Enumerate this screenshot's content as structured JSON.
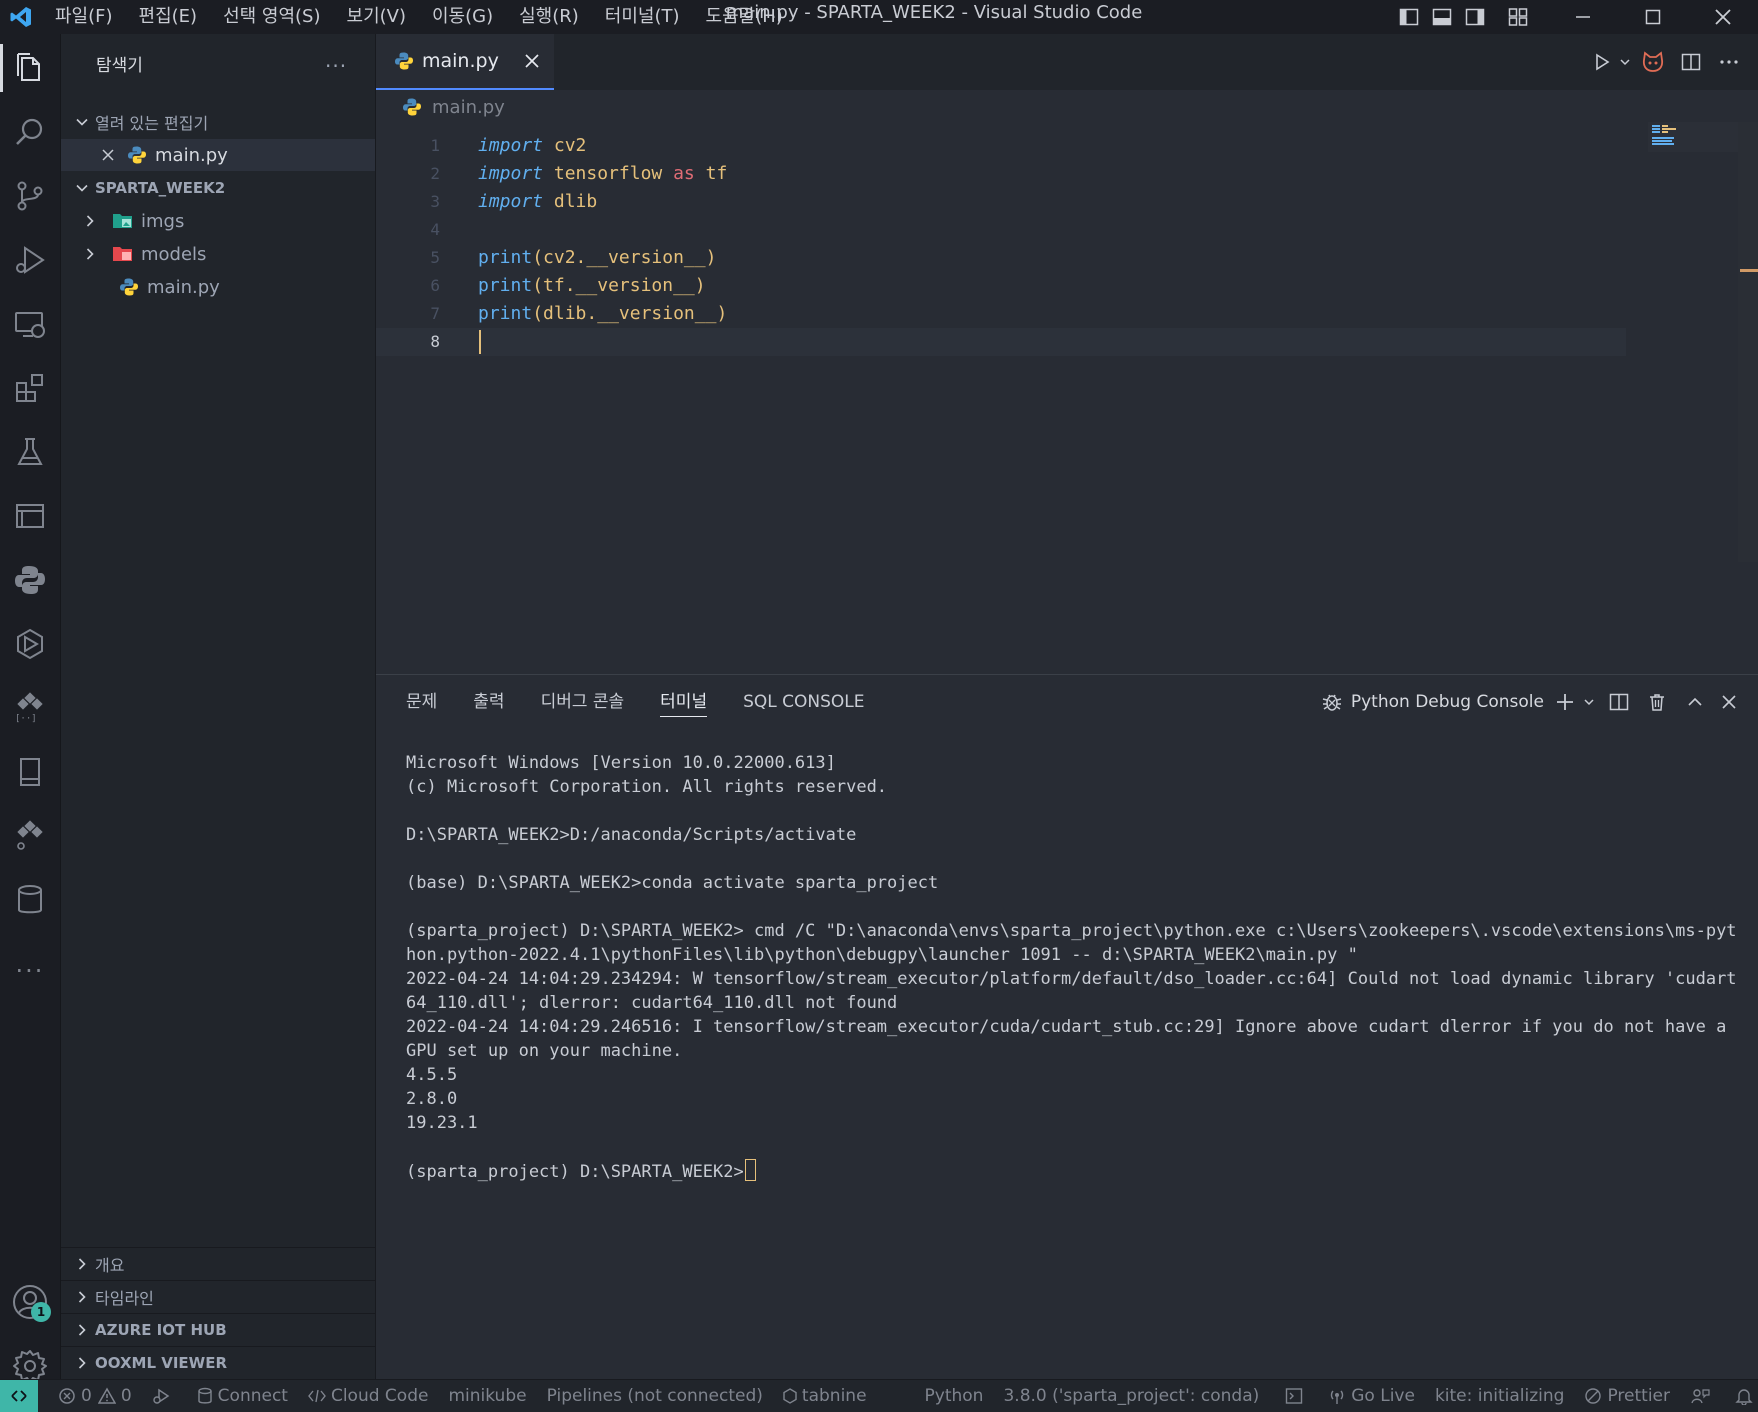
{
  "titlebar": {
    "menu": [
      "파일(F)",
      "편집(E)",
      "선택 영역(S)",
      "보기(V)",
      "이동(G)",
      "실행(R)",
      "터미널(T)",
      "도움말(H)"
    ],
    "window_title": "main.py - SPARTA_WEEK2 - Visual Studio Code"
  },
  "activitybar": {
    "icons": [
      "explorer-icon",
      "search-icon",
      "source-control-icon",
      "run-debug-icon",
      "remote-explorer-icon",
      "extensions-icon",
      "testing-icon",
      "panel-icon",
      "python-icon",
      "kubernetes-icon",
      "tabnine-icon",
      "book-icon",
      "pipelines-icon",
      "database-icon",
      "more-icon"
    ],
    "accounts_badge": "1",
    "more": "..."
  },
  "sidebar": {
    "title": "탐색기",
    "more": "...",
    "open_editors": {
      "label": "열려 있는 편집기",
      "items": [
        {
          "name": "main.py"
        }
      ]
    },
    "folder": {
      "label": "SPARTA_WEEK2",
      "items": [
        {
          "name": "imgs",
          "type": "folder"
        },
        {
          "name": "models",
          "type": "folder"
        },
        {
          "name": "main.py",
          "type": "file"
        }
      ]
    },
    "bottom_sections": [
      "개요",
      "타임라인",
      "AZURE IOT HUB",
      "OOXML VIEWER"
    ]
  },
  "editor": {
    "tab": {
      "label": "main.py"
    },
    "breadcrumb": "main.py",
    "line_numbers": [
      "1",
      "2",
      "3",
      "4",
      "5",
      "6",
      "7",
      "8"
    ],
    "code": {
      "l1": {
        "kw": "import",
        "mod": "cv2"
      },
      "l2": {
        "kw": "import",
        "mod": "tensorflow",
        "as": "as",
        "alias": "tf"
      },
      "l3": {
        "kw": "import",
        "mod": "dlib"
      },
      "l5": {
        "fn": "print",
        "open": "(",
        "obj": "cv2",
        "attr": ".__version__",
        "close": ")"
      },
      "l6": {
        "fn": "print",
        "open": "(",
        "obj": "tf",
        "attr": ".__version__",
        "close": ")"
      },
      "l7": {
        "fn": "print",
        "open": "(",
        "obj": "dlib",
        "attr": ".__version__",
        "close": ")"
      }
    }
  },
  "panel": {
    "tabs": [
      "문제",
      "출력",
      "디버그 콘솔",
      "터미널",
      "SQL CONSOLE"
    ],
    "active_tab": "터미널",
    "terminal_name": "Python Debug Console",
    "terminal_lines": [
      "Microsoft Windows [Version 10.0.22000.613]",
      "(c) Microsoft Corporation. All rights reserved.",
      "",
      "D:\\SPARTA_WEEK2>D:/anaconda/Scripts/activate",
      "",
      "(base) D:\\SPARTA_WEEK2>conda activate sparta_project",
      "",
      "(sparta_project) D:\\SPARTA_WEEK2> cmd /C \"D:\\anaconda\\envs\\sparta_project\\python.exe c:\\Users\\zookeepers\\.vscode\\extensions\\ms-python.python-2022.4.1\\pythonFiles\\lib\\python\\debugpy\\launcher 1091 -- d:\\SPARTA_WEEK2\\main.py \"",
      "2022-04-24 14:04:29.234294: W tensorflow/stream_executor/platform/default/dso_loader.cc:64] Could not load dynamic library 'cudart64_110.dll'; dlerror: cudart64_110.dll not found",
      "2022-04-24 14:04:29.246516: I tensorflow/stream_executor/cuda/cudart_stub.cc:29] Ignore above cudart dlerror if you do not have a GPU set up on your machine.",
      "4.5.5",
      "2.8.0",
      "19.23.1",
      ""
    ],
    "prompt": "(sparta_project) D:\\SPARTA_WEEK2>"
  },
  "statusbar": {
    "errors": "0",
    "warnings": "0",
    "connect": "Connect",
    "cloud_code": "Cloud Code",
    "minikube": "minikube",
    "pipelines": "Pipelines (not connected)",
    "tabnine": "tabnine",
    "language": "Python",
    "interpreter": "3.8.0 ('sparta_project': conda)",
    "go_live": "Go Live",
    "kite": "kite: initializing",
    "prettier": "Prettier"
  },
  "colors": {
    "accent": "#3fb6a8",
    "keyword": "#61afef",
    "module": "#e5c07b",
    "as_keyword": "#e06c75"
  }
}
